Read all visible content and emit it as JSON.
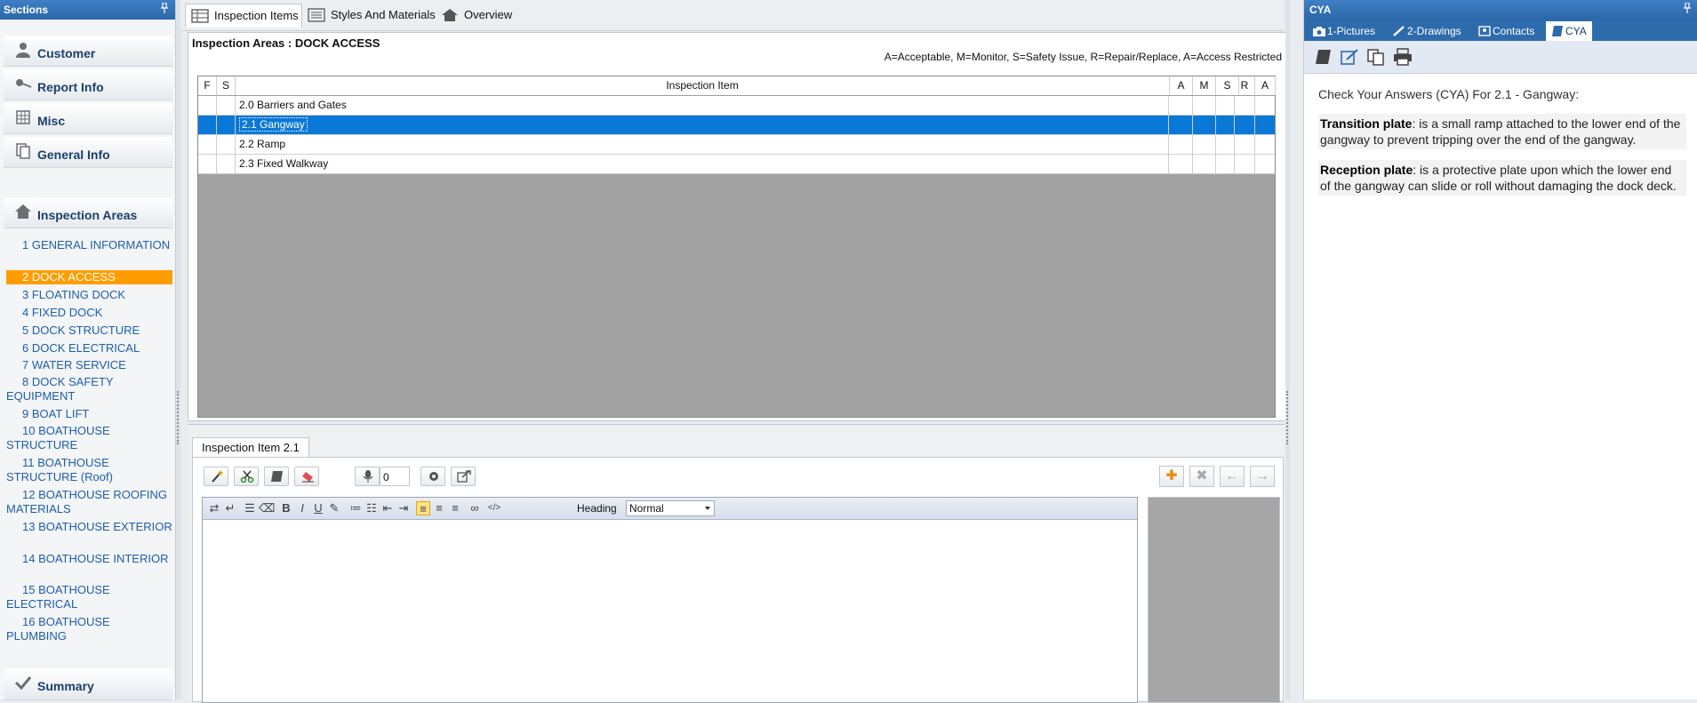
{
  "sidebar": {
    "title": "Sections",
    "sections": [
      {
        "label": "Customer",
        "icon": "person-icon"
      },
      {
        "label": "Report Info",
        "icon": "pin-icon"
      },
      {
        "label": "Misc",
        "icon": "table-icon"
      },
      {
        "label": "General Info",
        "icon": "documents-icon"
      },
      {
        "label": "Inspection Areas",
        "icon": "home-icon"
      }
    ],
    "areas": [
      "1 GENERAL INFORMATION",
      "2 DOCK ACCESS",
      "3 FLOATING DOCK",
      "4 FIXED DOCK",
      "5 DOCK STRUCTURE",
      "6 DOCK ELECTRICAL",
      "7 WATER SERVICE",
      "8 DOCK SAFETY EQUIPMENT",
      "9 BOAT LIFT",
      "10 BOATHOUSE STRUCTURE",
      "11 BOATHOUSE STRUCTURE (Roof)",
      "12 BOATHOUSE ROOFING MATERIALS",
      "13 BOATHOUSE EXTERIOR",
      "14 BOATHOUSE INTERIOR",
      "15 BOATHOUSE ELECTRICAL",
      "16 BOATHOUSE PLUMBING"
    ],
    "selected_area_index": 1,
    "summary_label": "Summary"
  },
  "top_tabs": [
    {
      "label": "Inspection Items",
      "icon": "grid-icon"
    },
    {
      "label": "Styles And Materials",
      "icon": "list-icon"
    },
    {
      "label": "Overview",
      "icon": "home-icon"
    }
  ],
  "inspection": {
    "title": "Inspection Areas : DOCK ACCESS",
    "legend": "A=Acceptable, M=Monitor, S=Safety Issue, R=Repair/Replace, A=Access Restricted",
    "columns": {
      "f": "F",
      "s": "S",
      "item": "Inspection Item",
      "a": "A",
      "m": "M",
      "s2": "S",
      "r": "R",
      "a2": "A"
    },
    "rows": [
      "2.0 Barriers and Gates",
      "2.1 Gangway",
      "2.2 Ramp",
      "2.3 Fixed Walkway"
    ],
    "selected_row_index": 1
  },
  "lower": {
    "tab_label": "Inspection Item 2.1",
    "counter_value": "0",
    "heading_label": "Heading",
    "heading_value": "Normal"
  },
  "right": {
    "title": "CYA",
    "tabs": [
      {
        "label": "1-Pictures",
        "icon": "camera-icon"
      },
      {
        "label": "2-Drawings",
        "icon": "pencil-icon"
      },
      {
        "label": "Contacts",
        "icon": "contacts-icon"
      },
      {
        "label": "CYA",
        "icon": "book-icon"
      }
    ],
    "intro": "Check Your Answers (CYA) For 2.1 - Gangway:",
    "entries": [
      {
        "term": "Transition plate",
        "text": ": is a small ramp attached to the lower end of the gangway to prevent tripping over the end of the gangway."
      },
      {
        "term": "Reception plate",
        "text": ": is a protective plate upon which the lower end of the gangway can slide or roll without damaging the dock deck."
      }
    ]
  },
  "colors": {
    "accent": "#2b67a9",
    "selected_area": "#ff9d00",
    "selected_row": "#0a78d7"
  }
}
